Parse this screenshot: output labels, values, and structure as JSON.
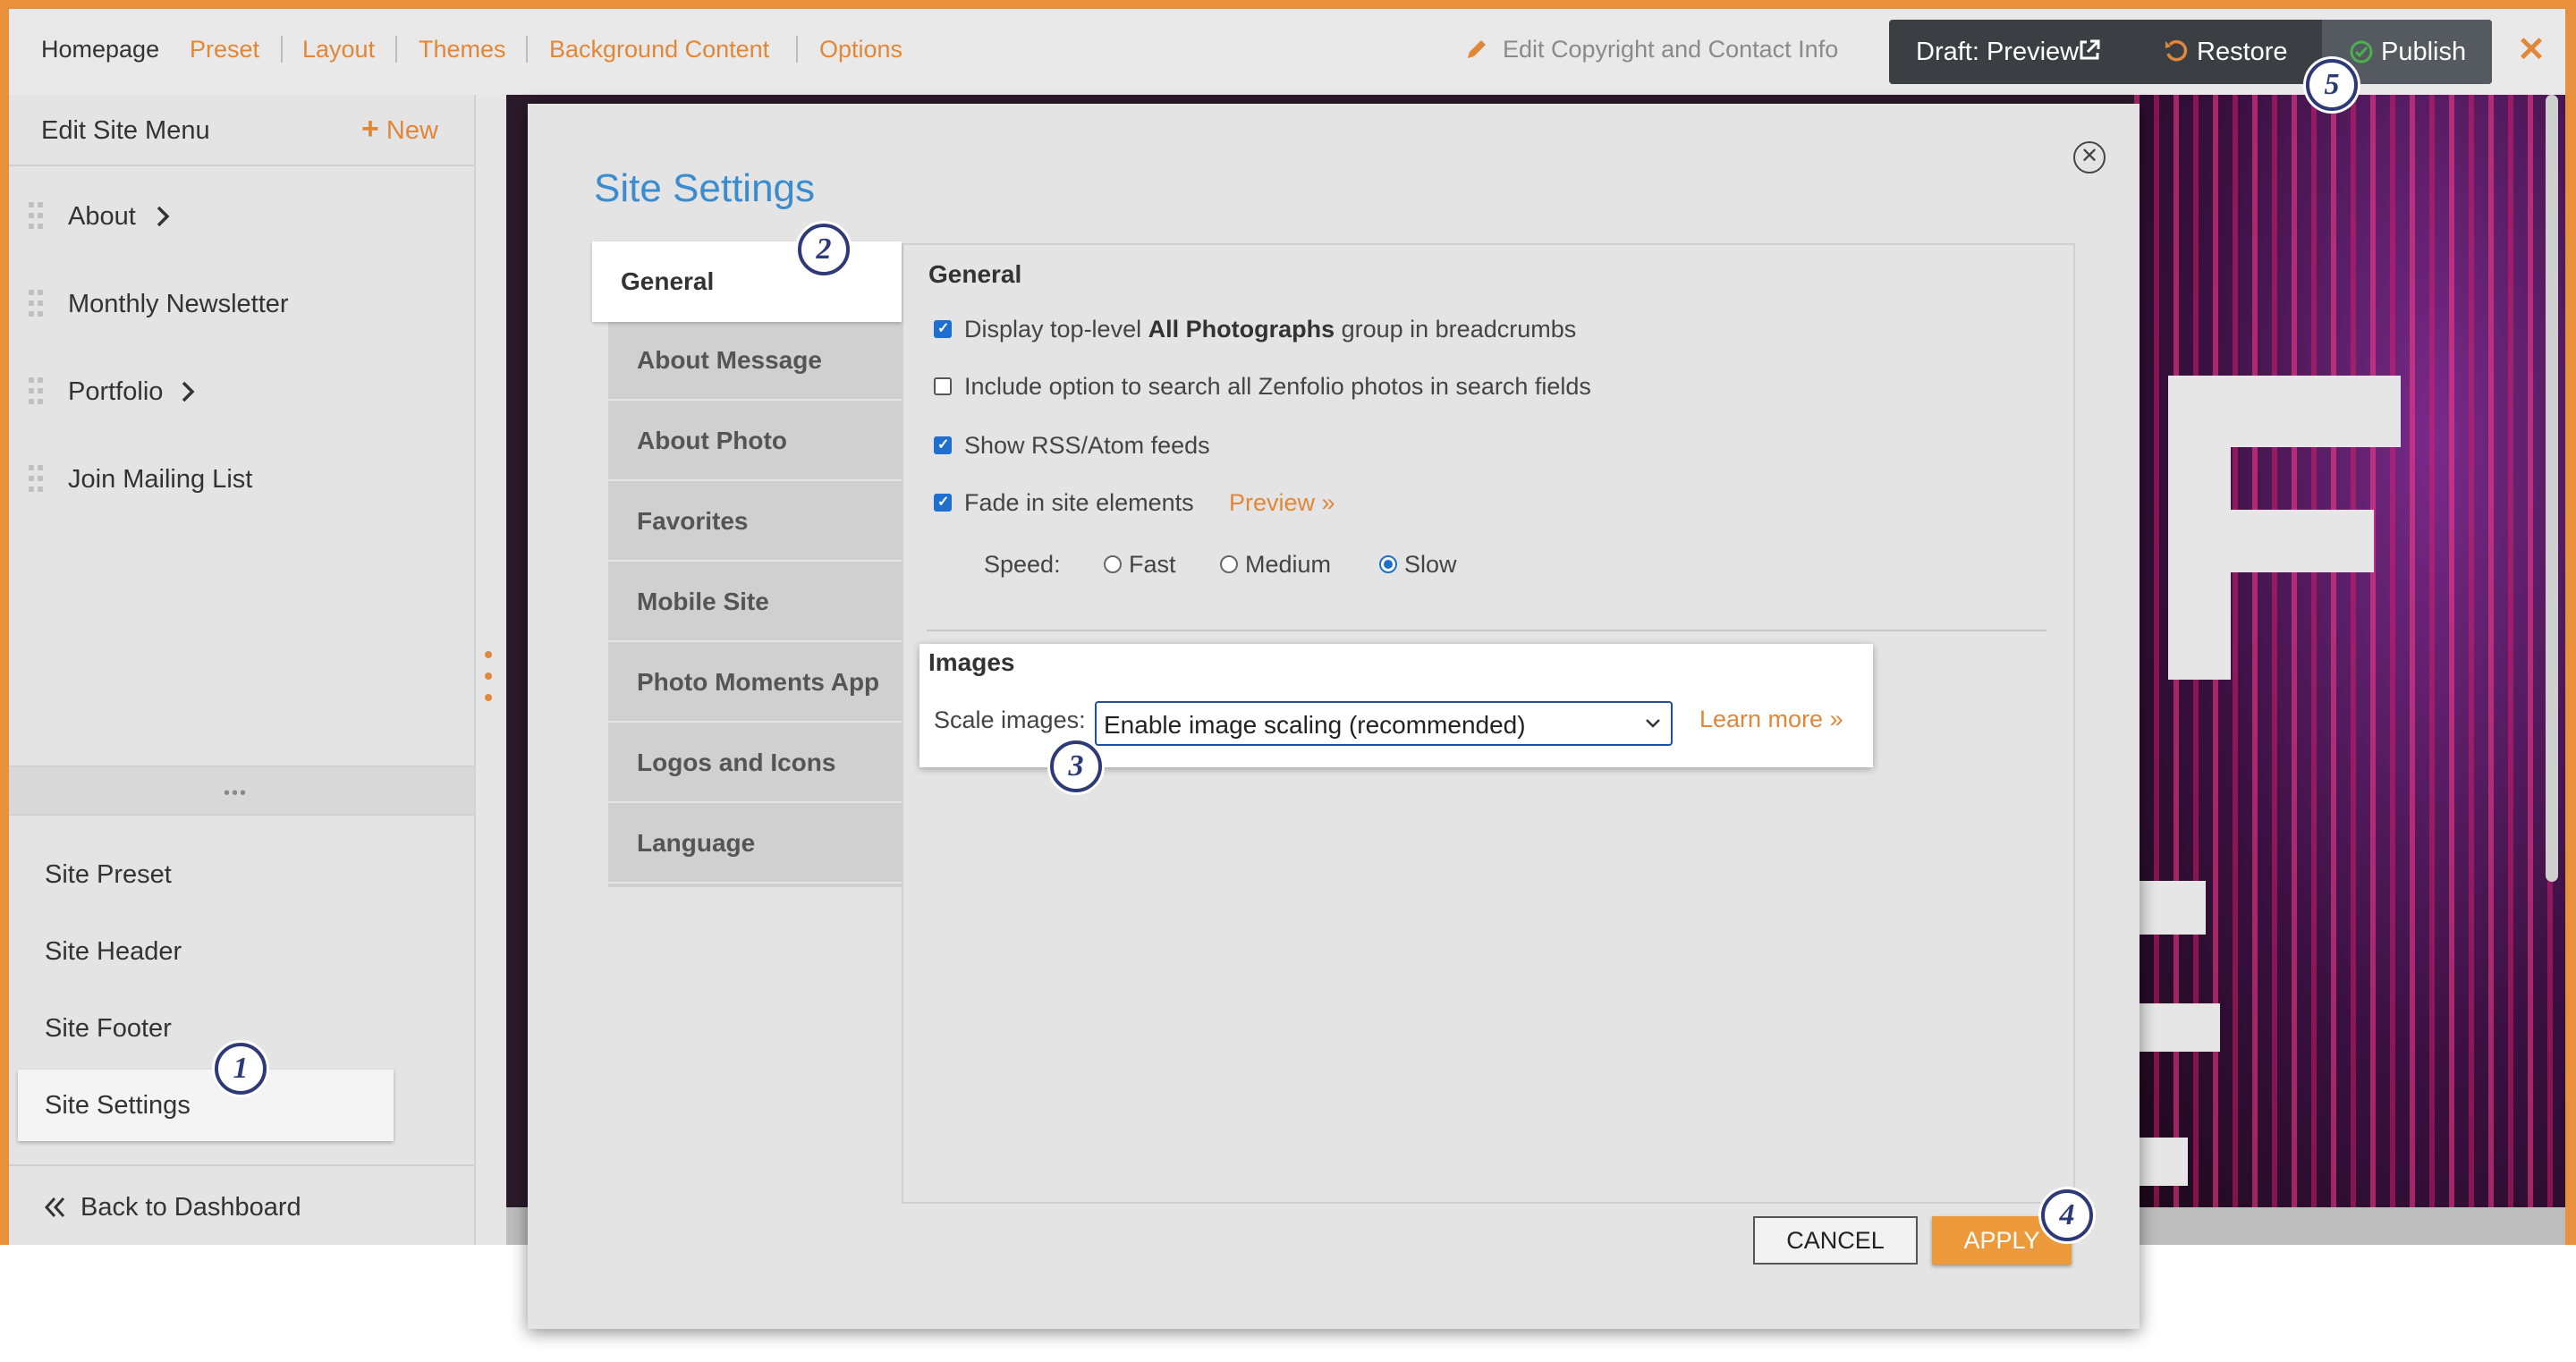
{
  "topnav": {
    "home": "Homepage",
    "links": [
      "Preset",
      "Layout",
      "Themes",
      "Background Content",
      "Options"
    ],
    "edit_copyright": "Edit Copyright and Contact Info",
    "draft_preview": "Draft: Preview",
    "restore": "Restore",
    "publish": "Publish"
  },
  "sidebar": {
    "title": "Edit Site Menu",
    "new_label": "New",
    "menu_items": [
      {
        "label": "About",
        "has_children": true
      },
      {
        "label": "Monthly Newsletter",
        "has_children": false
      },
      {
        "label": "Portfolio",
        "has_children": true
      },
      {
        "label": "Join Mailing List",
        "has_children": false
      }
    ],
    "settings_items": [
      "Site Preset",
      "Site Header",
      "Site Footer",
      "Site Settings"
    ],
    "selected_setting": "Site Settings",
    "back_label": "Back to Dashboard"
  },
  "modal": {
    "title": "Site Settings",
    "tabs": [
      "General",
      "About Message",
      "About Photo",
      "Favorites",
      "Mobile Site",
      "Photo Moments App",
      "Logos and Icons",
      "Language"
    ],
    "active_tab": "General",
    "general": {
      "heading": "General",
      "opt1_pre": "Display top-level ",
      "opt1_bold": "All Photographs",
      "opt1_post": " group in breadcrumbs",
      "opt1_checked": true,
      "opt2": "Include option to search all Zenfolio photos in search fields",
      "opt2_checked": false,
      "opt3": "Show RSS/Atom feeds",
      "opt3_checked": true,
      "opt4": "Fade in site elements",
      "opt4_checked": true,
      "preview_link": "Preview »",
      "speed_label": "Speed:",
      "speed_options": [
        "Fast",
        "Medium",
        "Slow"
      ],
      "speed_selected": "Slow"
    },
    "images": {
      "heading": "Images",
      "scale_label": "Scale images:",
      "scale_value": "Enable image scaling (recommended)",
      "learn_more": "Learn more »"
    },
    "cancel": "CANCEL",
    "apply": "APPLY"
  },
  "callouts": [
    "1",
    "2",
    "3",
    "4",
    "5"
  ],
  "colors": {
    "accent_orange": "#e0873a",
    "title_blue": "#3a8ccf",
    "checkbox_blue": "#1e6fcf",
    "callout_navy": "#2e3a78",
    "dark_bar": "#3b3f44"
  },
  "icons": {
    "pencil": "pencil-icon",
    "external": "external-link-icon",
    "restore": "undo-icon",
    "publish": "check-circle-icon",
    "close": "close-icon",
    "drag": "drag-handle-icon",
    "chevron": "chevron-right-icon",
    "back": "double-chevron-left-icon"
  }
}
